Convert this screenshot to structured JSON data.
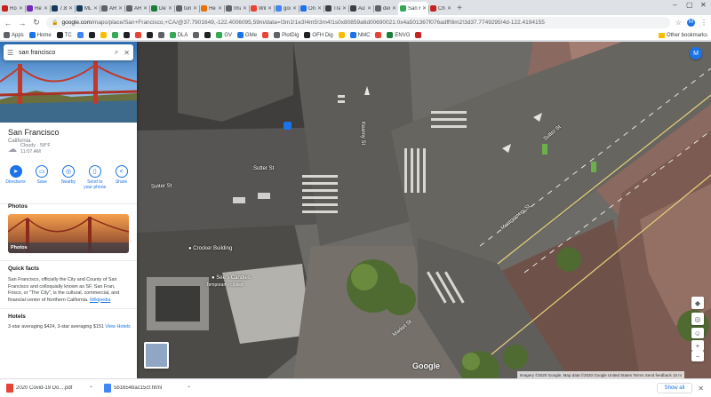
{
  "browser": {
    "tabs": [
      {
        "title": "Road",
        "color": "#c5221f"
      },
      {
        "title": "Rethi",
        "color": "#7627bb"
      },
      {
        "title": "7.8 n",
        "color": "#12395d"
      },
      {
        "title": "MLT",
        "color": "#12395d"
      },
      {
        "title": "AR-C",
        "color": "#5f6368"
      },
      {
        "title": "AR-C",
        "color": "#5f6368"
      },
      {
        "title": "Delh",
        "color": "#188038"
      },
      {
        "title": "turn",
        "color": "#5f6368"
      },
      {
        "title": "Help",
        "color": "#e8710a"
      },
      {
        "title": "Imag",
        "color": "#5f6368"
      },
      {
        "title": "Will",
        "color": "#ea4335"
      },
      {
        "title": "goog",
        "color": "#4285f4"
      },
      {
        "title": "One",
        "color": "#1a73e8"
      },
      {
        "title": "Tran",
        "color": "#3c4043"
      },
      {
        "title": "Auto",
        "color": "#3c4043"
      },
      {
        "title": "dem",
        "color": "#5f6368"
      },
      {
        "title": "San F",
        "color": "#34a853",
        "active": true
      },
      {
        "title": "Chen",
        "color": "#c5221f"
      }
    ],
    "new_tab": "+",
    "url_host": "google.com",
    "url_path": "/maps/place/San+Francisco,+CA/@37.7901649,-122.4006095,59m/data=!3m1!1e3!4m5!3m4!1s0x80859a6d00690021:0x4a501367f076adff!8m2!3d37.7749295!4d-122.4194155",
    "bookmarks": [
      {
        "label": "Apps",
        "color": "#5f6368"
      },
      {
        "label": "Home",
        "color": "#1a73e8"
      },
      {
        "label": "TC",
        "color": "#202124"
      },
      {
        "label": "",
        "color": "#4285f4"
      },
      {
        "label": "",
        "color": "#202124"
      },
      {
        "label": "",
        "color": "#fbbc04"
      },
      {
        "label": "",
        "color": "#34a853"
      },
      {
        "label": "",
        "color": "#202124"
      },
      {
        "label": "",
        "color": "#ea4335"
      },
      {
        "label": "",
        "color": "#202124"
      },
      {
        "label": "",
        "color": "#5f6368"
      },
      {
        "label": "DLA",
        "color": "#34a853"
      },
      {
        "label": "",
        "color": "#5f6368"
      },
      {
        "label": "",
        "color": "#202124"
      },
      {
        "label": "GV",
        "color": "#34a853"
      },
      {
        "label": "GMe",
        "color": "#1a73e8"
      },
      {
        "label": "",
        "color": "#ea4335"
      },
      {
        "label": "PlotDig",
        "color": "#5f6368"
      },
      {
        "label": "OFH Dig",
        "color": "#202124"
      },
      {
        "label": "",
        "color": "#fbbc04"
      },
      {
        "label": "NMC",
        "color": "#1a73e8"
      },
      {
        "label": "",
        "color": "#ea4335"
      },
      {
        "label": "ENVG",
        "color": "#188038"
      },
      {
        "label": "",
        "color": "#c5221f"
      }
    ],
    "other_bookmarks": "Other bookmarks"
  },
  "sidebar": {
    "search_value": "san francisco",
    "place_name": "San Francisco",
    "region": "California",
    "weather_line1": "Cloudy · 58°F",
    "weather_line2": "11:07 AM",
    "actions": [
      {
        "label": "Directions",
        "icon": "directions-icon",
        "glyph": "➤",
        "filled": true
      },
      {
        "label": "Save",
        "icon": "bookmark-icon",
        "glyph": "▭"
      },
      {
        "label": "Nearby",
        "icon": "nearby-icon",
        "glyph": "◎"
      },
      {
        "label": "Send to your phone",
        "icon": "phone-icon",
        "glyph": "▯"
      },
      {
        "label": "Share",
        "icon": "share-icon",
        "glyph": "<"
      }
    ],
    "photos_title": "Photos",
    "photo_label": "Photos",
    "facts_title": "Quick facts",
    "facts_text": "San Francisco, officially the City and County of San Francisco and colloquially known as SF, San Fran, Frisco, or \"The City\", is the cultural, commercial, and financial center of Northern California.",
    "facts_link": "Wikipedia",
    "hotels_title": "Hotels",
    "hotels_text": "3-star averaging $424, 3-star averaging $151",
    "hotels_link": "View Hotels"
  },
  "map": {
    "labels": {
      "sutter_st_1": "Sutter St",
      "sutter_st_2": "Sutter St",
      "montgomery": "Montgomery St",
      "new_montgomery": "Sutter St",
      "kearny": "Kearny St",
      "crocker": "Crocker Building",
      "sees": "See's Candies",
      "sees_sub": "Temporarily closed",
      "market_st": "Market St"
    },
    "google": "Google",
    "attribution": "Imagery ©2020 Google, Map data ©2020 Google   United States   Terms   Send feedback   10 m"
  },
  "downloads": {
    "items": [
      {
        "name": "2020 Covid-19 Do....pdf",
        "color": "#ea4335"
      },
      {
        "name": "5b1654bac15cf.html",
        "color": "#4285f4"
      }
    ],
    "show_all": "Show all"
  }
}
